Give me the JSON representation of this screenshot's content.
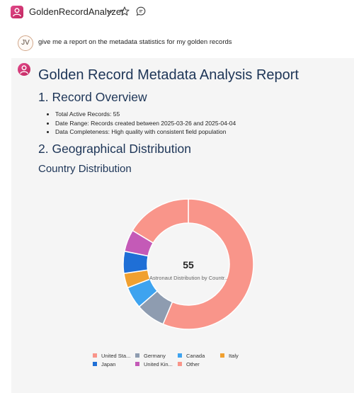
{
  "header": {
    "app_title": "GoldenRecordAnalyzer",
    "chevron_icon": "chevron-down-icon",
    "star_icon": "star-icon",
    "chat_icon": "chat-bubble-icon"
  },
  "user": {
    "initials": "JV",
    "message": "give me a report on the metadata statistics for my golden records"
  },
  "report": {
    "title": "Golden Record Metadata Analysis Report",
    "section1": "1. Record Overview",
    "bullets": [
      "Total Active Records: 55",
      "Date Range: Records created between 2025-03-26 and 2025-04-04",
      "Data Completeness: High quality with consistent field population"
    ],
    "section2": "2. Geographical Distribution",
    "subsection": "Country Distribution"
  },
  "chart_data": {
    "type": "pie",
    "center_value": "55",
    "center_label": "Astronaut Distribution by Countr..",
    "legend_position": "bottom",
    "categories": [
      "United Sta...",
      "Germany",
      "Canada",
      "Italy",
      "Japan",
      "United Kin...",
      "Other"
    ],
    "values": [
      31,
      4,
      3,
      2,
      3,
      3,
      9
    ],
    "colors": [
      "#f9958a",
      "#8e9cb0",
      "#3ea3ef",
      "#f0a030",
      "#1f6fd6",
      "#c45ab7",
      "#f9958a"
    ]
  }
}
